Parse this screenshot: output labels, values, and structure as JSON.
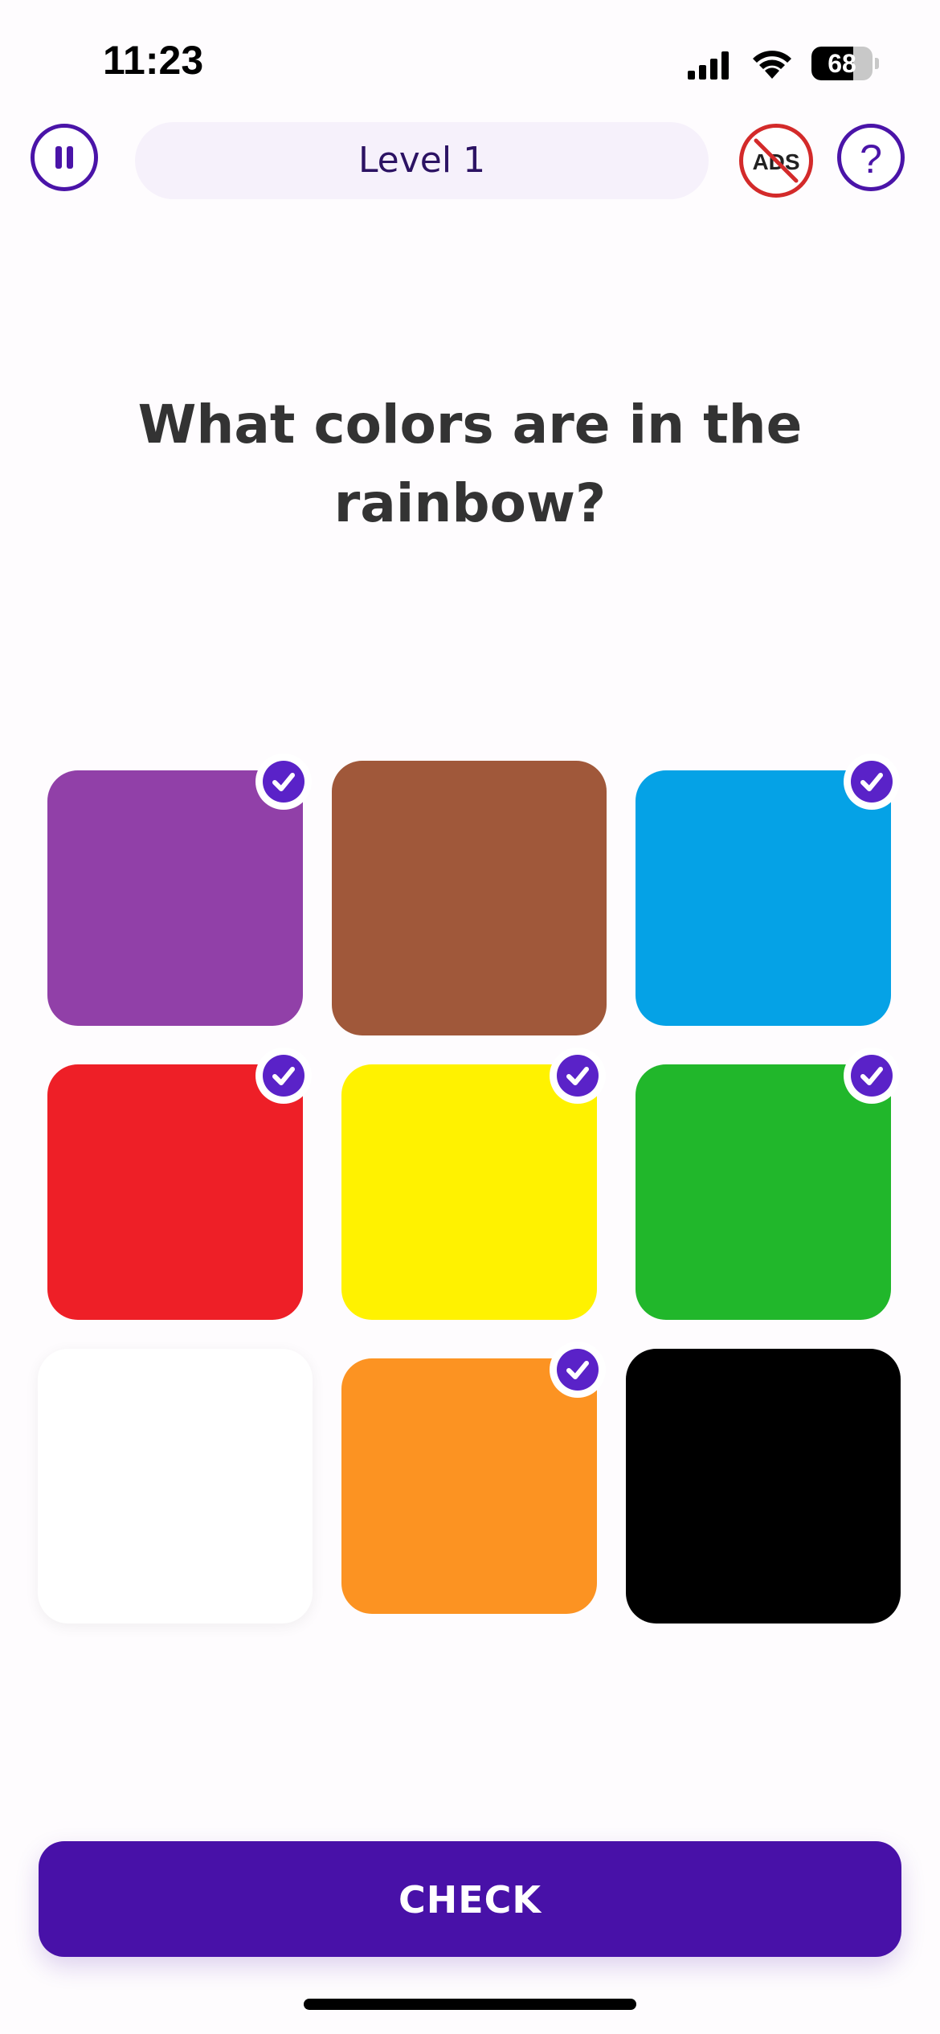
{
  "status_bar": {
    "time": "11:23",
    "battery_level": "68",
    "battery_fraction": 0.68
  },
  "header": {
    "level_label": "Level 1",
    "help_label": "?",
    "no_ads_icon": "no-ads-icon",
    "pause_icon": "pause-icon"
  },
  "question": "What colors are in the rainbow?",
  "tiles": [
    {
      "color_name": "purple",
      "color": "#9140a8",
      "selected": true
    },
    {
      "color_name": "brown",
      "color": "#a0583a",
      "selected": false
    },
    {
      "color_name": "blue",
      "color": "#05a2e6",
      "selected": true
    },
    {
      "color_name": "red",
      "color": "#ee1f27",
      "selected": true
    },
    {
      "color_name": "yellow",
      "color": "#fff200",
      "selected": true
    },
    {
      "color_name": "green",
      "color": "#21b72b",
      "selected": true
    },
    {
      "color_name": "white",
      "color": "#ffffff",
      "selected": false
    },
    {
      "color_name": "orange",
      "color": "#fc9322",
      "selected": true
    },
    {
      "color_name": "black",
      "color": "#000000",
      "selected": false
    }
  ],
  "check_button_label": "CHECK",
  "colors": {
    "accent": "#4811a8",
    "check_badge": "#5a22c8",
    "no_ads_red": "#d32a2a"
  }
}
